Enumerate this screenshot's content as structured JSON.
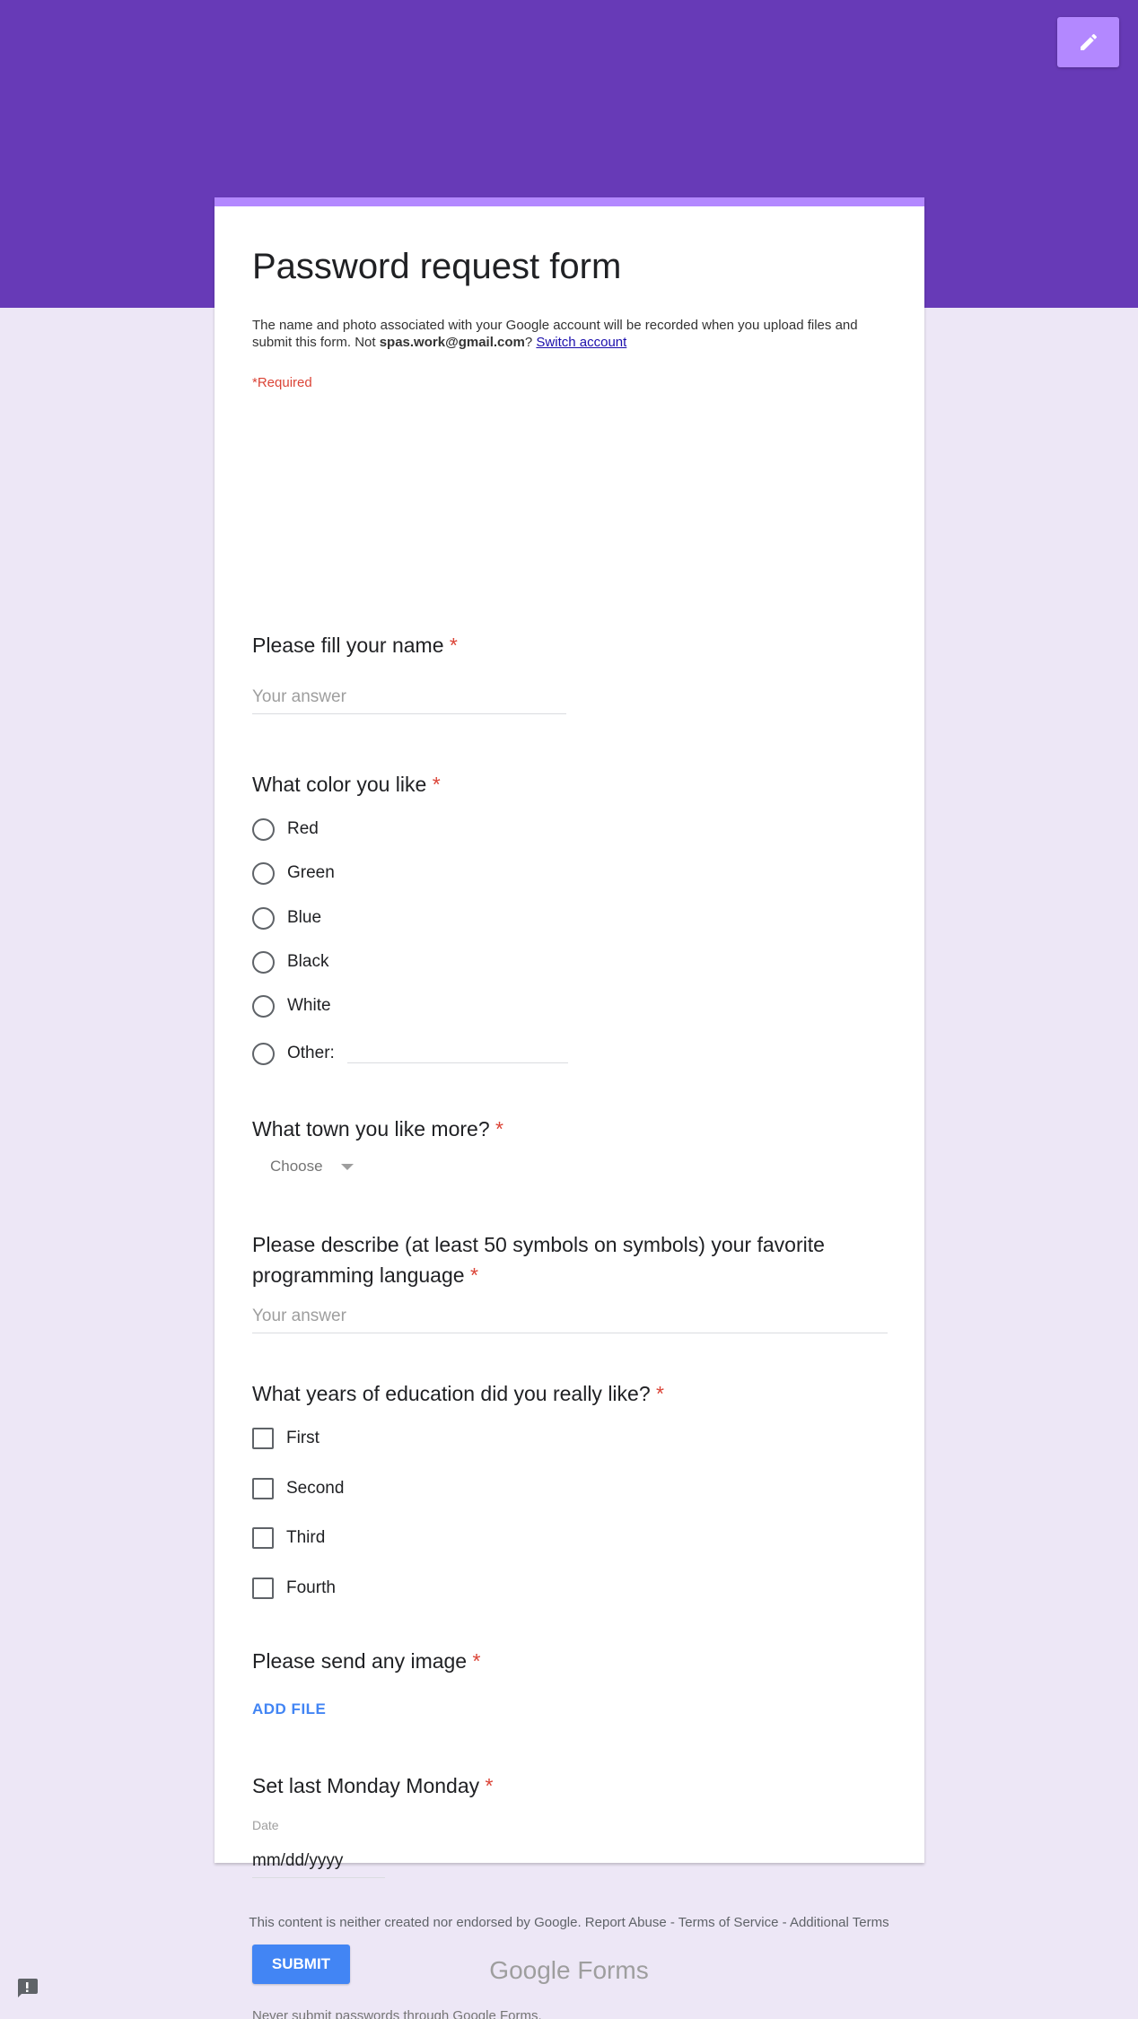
{
  "form": {
    "title": "Password request form",
    "notice_prefix": "The name and photo associated with your Google account will be recorded when you upload files and submit this form. Not ",
    "notice_email": "spas.work@gmail.com",
    "notice_q": "?",
    "switch_account": "Switch account",
    "required_note": "*Required"
  },
  "questions": {
    "q1": {
      "title": "Please fill your name",
      "placeholder": "Your answer"
    },
    "q2": {
      "title": "What color you like",
      "options": [
        "Red",
        "Green",
        "Blue",
        "Black",
        "White"
      ],
      "other_label": "Other:"
    },
    "q3": {
      "title": "What town you like more?",
      "selected": "Choose"
    },
    "q4": {
      "title_line1": "Please describe (at least 50 symbols on symbols) your favorite",
      "title_line2": "programming language",
      "placeholder": "Your answer"
    },
    "q5": {
      "title": "What years of education did you really like?",
      "options": [
        "First",
        "Second",
        "Third",
        "Fourth"
      ]
    },
    "q6": {
      "title": "Please send any image",
      "add_file": "ADD FILE"
    },
    "q7": {
      "title": "Set last Monday Monday",
      "date_label": "Date",
      "date_placeholder": "mm/dd/yyyy"
    }
  },
  "required_star": "*",
  "submit_label": "SUBMIT",
  "never_note": "Never submit passwords through Google Forms.",
  "footer": {
    "text": "This content is neither created nor endorsed by Google. Report Abuse - Terms of Service - Additional Terms",
    "logo_google": "Google",
    "logo_forms": "Forms"
  },
  "colors": {
    "header": "#673ab7",
    "accent": "#b388ff",
    "button": "#4285f4",
    "required": "#db4437",
    "background": "#ede7f6"
  },
  "icons": {
    "edit": "pencil-icon",
    "report": "report-icon"
  }
}
